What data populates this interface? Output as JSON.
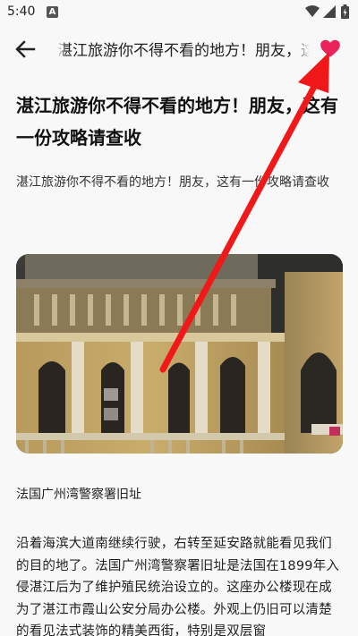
{
  "status_bar": {
    "time": "5:40",
    "notification_letter": "A"
  },
  "appbar": {
    "title": "湛江旅游你不得不看的地方！朋友，这有一份攻略请查收",
    "back_icon": "arrow-left-icon",
    "favorite_icon": "heart-icon",
    "favorite_color": "#e8245a"
  },
  "article": {
    "title": "湛江旅游你不得不看的地方！朋友，这有一份攻略请查收",
    "summary": "湛江旅游你不得不看的地方！朋友，这有一份攻略请查收",
    "image_caption": "法国广州湾警察署旧址",
    "paragraph": "沿着海滨大道南继续行驶，右转至延安路就能看见我们的目的地了。法国广州湾警察署旧址是法国在1899年入侵湛江后为了维护殖民统治设立的。这座办公楼现在成为了湛江市霞山公安分局办公楼。外观上仍旧可以清楚的看见法式装饰的精美西街，特别是双层窗"
  },
  "annotation": {
    "arrow_color": "#f01818"
  }
}
